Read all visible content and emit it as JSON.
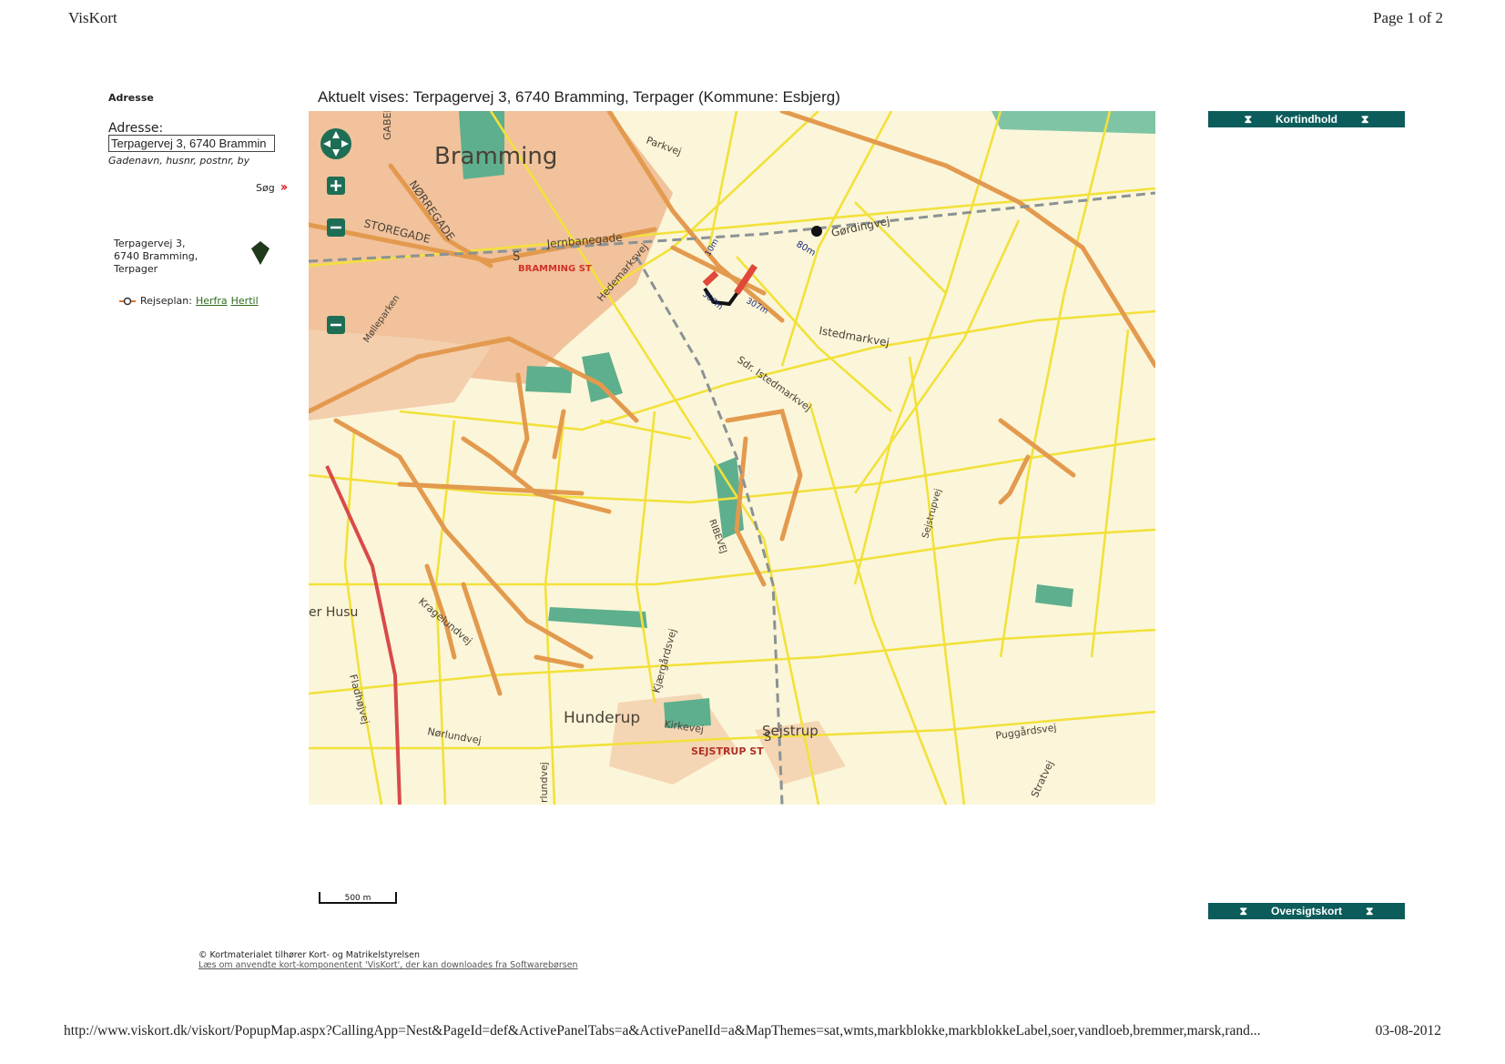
{
  "header": {
    "app_title": "VisKort",
    "page_indicator": "Page 1 of 2"
  },
  "sidebar": {
    "heading": "Adresse",
    "address_label": "Adresse:",
    "address_value": "Terpagervej 3, 6740 Brammin",
    "address_hint": "Gadenavn, husnr, postnr, by",
    "search_label": "Søg",
    "result": {
      "line1": "Terpagervej 3,",
      "line2": "6740 Bramming,",
      "line3": "Terpager"
    },
    "travel": {
      "label": "Rejseplan:",
      "from_link": "Herfra",
      "to_link": "Hertil"
    }
  },
  "map": {
    "title": "Aktuelt vises: Terpagervej 3, 6740 Bramming, Terpager (Kommune: Esbjerg)",
    "labels": {
      "town_bramming": "Bramming",
      "town_hunderup": "Hunderup",
      "town_sejstrup": "Sejstrup",
      "station_bramming": "BRAMMING ST",
      "station_sejstrup": "SEJSTRUP ST",
      "station_symbol": "S",
      "road_storegade": "STOREGADE",
      "road_norregade": "NØRREGADE",
      "road_gabel": "GABEL",
      "road_jernbanegade": "Jernbanegade",
      "road_hedemarksvej": "Hedemarksvej",
      "road_parkvej": "Parkvej",
      "road_gordingvej": "Gørdingvej",
      "road_istedmarkvej": "Istedmarkvej",
      "road_sdr_istedmarkvej": "Sdr. Istedmarkvej",
      "road_kirkegaardsvej": "Kjærgårdsvej",
      "road_kirkevej": "Kirkevej",
      "road_norlundvej": "Nørlundvej",
      "road_puggaardsvej": "Puggårdsvej",
      "road_stratvej": "Stratvej",
      "road_fladhojvej": "Fladhøjvej",
      "road_kragelundvej": "Kragelundvej",
      "road_sejstrupvej": "Sejstrupvej",
      "road_husum": "er Husu",
      "road_rlundvej": "rlundvej",
      "road_ribevej": "RIBEVEJ",
      "road_molleparken": "Mølleparken"
    },
    "annotations": {
      "a1": "307m",
      "a2": "307m",
      "a3": "80m",
      "a4": "10m"
    },
    "scale_label": "500 m",
    "colors": {
      "background": "#fbf6d9",
      "minor_road": "#f2e13b",
      "major_road": "#e39a4e",
      "urban": "#f1c29b",
      "forest": "#5eaf8d",
      "rail": "#8a9294",
      "highway": "#d94a4a"
    }
  },
  "panels": {
    "top": "Kortindhold",
    "bottom": "Oversigtskort"
  },
  "copyright": {
    "line1": "© Kortmaterialet tilhører Kort- og Matrikelstyrelsen",
    "line2": "Læs om anvendte kort-komponentent 'VisKort', der kan downloades fra Softwarebørsen"
  },
  "footer": {
    "url": "http://www.viskort.dk/viskort/PopupMap.aspx?CallingApp=Nest&PageId=def&ActivePanelTabs=a&ActivePanelId=a&MapThemes=sat,wmts,markblokke,markblokkeLabel,soer,vandloeb,bremmer,marsk,rand...",
    "date": "03-08-2012"
  }
}
